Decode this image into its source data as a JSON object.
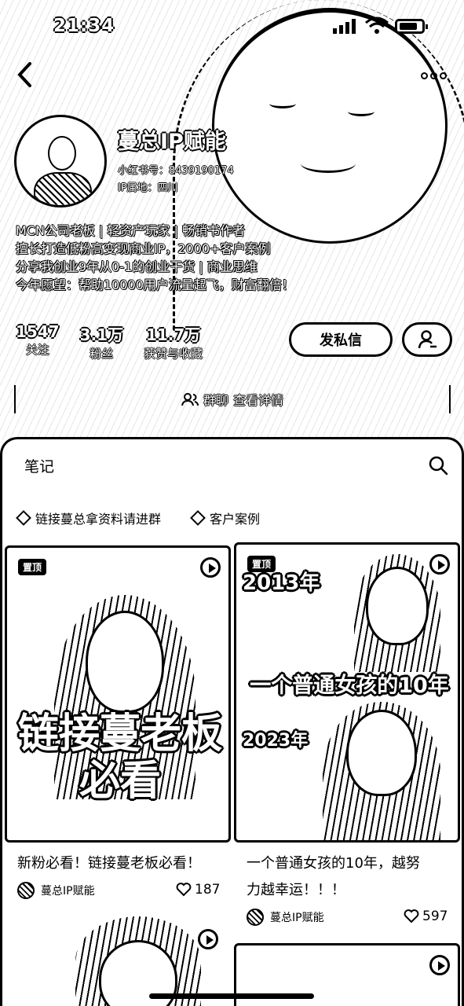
{
  "status_bar": {
    "time": "21:34"
  },
  "profile": {
    "name": "蔓总IP赋能",
    "xhs_id": "小红书号：8439190174",
    "ip_location": "IP属地：四川",
    "bio": [
      "MCN公司老板 | 轻资产玩家 | 畅销书作者",
      "擅长打造低粉高变现商业IP，2000+客户案例",
      "分享我创业9年从0-1的创业干货 | 商业思维",
      "今年愿望：帮助10000用户流量起飞，财富翻倍！"
    ],
    "stats": [
      {
        "value": "1547",
        "label": "关注"
      },
      {
        "value": "3.1万",
        "label": "粉丝"
      },
      {
        "value": "11.7万",
        "label": "获赞与收藏"
      }
    ],
    "dm_label": "发私信",
    "group_label": "群聊",
    "group_detail": "查看详情"
  },
  "notes": {
    "tab_label": "笔记",
    "chips": [
      "链接蔓总拿资料请进群",
      "客户案例"
    ],
    "cards": [
      {
        "pinned": "置顶",
        "caption": [
          "链接蔓老板",
          "必看"
        ],
        "title": "新粉必看！链接蔓老板必看！",
        "author": "蔓总IP赋能",
        "likes": "187"
      },
      {
        "pinned": "置顶",
        "caption_top": "2013年",
        "caption_mid": "一个普通女孩的10年",
        "caption_bottom": "2023年",
        "title": [
          "一个普通女孩的10年，越努",
          "力越幸运！！！"
        ],
        "author": "蔓总IP赋能",
        "likes": "597"
      }
    ]
  },
  "icons": {
    "back": "chevron-left-icon",
    "more": "more-dots-icon",
    "search": "search-icon",
    "follow": "add-person-icon",
    "group": "group-chat-icon",
    "chip": "diamond-icon",
    "play": "play-icon",
    "like": "heart-icon"
  }
}
